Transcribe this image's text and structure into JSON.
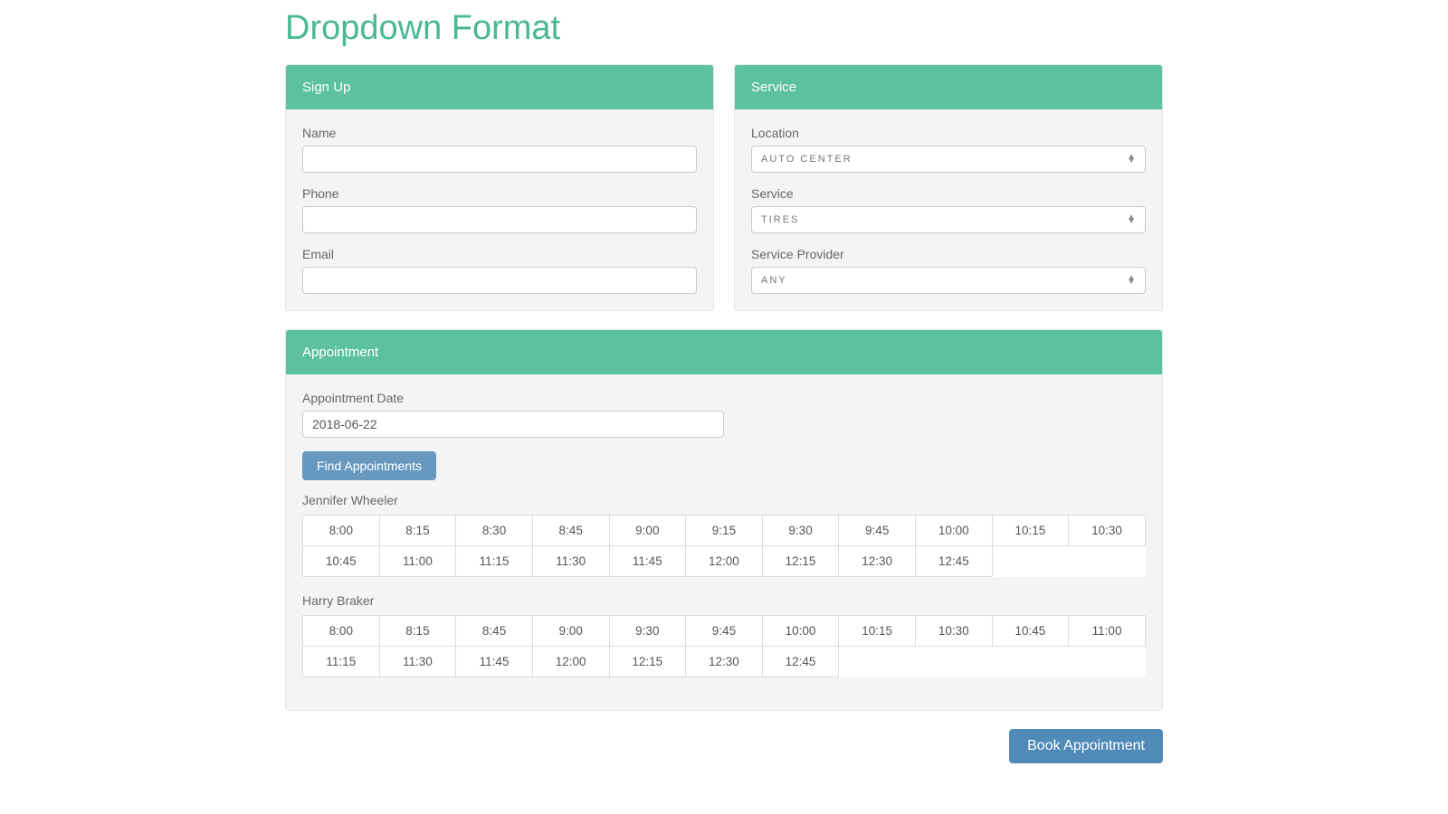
{
  "pageTitle": "Dropdown Format",
  "signup": {
    "heading": "Sign Up",
    "nameLabel": "Name",
    "nameValue": "",
    "phoneLabel": "Phone",
    "phoneValue": "",
    "emailLabel": "Email",
    "emailValue": ""
  },
  "service": {
    "heading": "Service",
    "locationLabel": "Location",
    "locationValue": "AUTO CENTER",
    "serviceLabel": "Service",
    "serviceValue": "TIRES",
    "providerLabel": "Service Provider",
    "providerValue": "ANY"
  },
  "appointment": {
    "heading": "Appointment",
    "dateLabel": "Appointment Date",
    "dateValue": "2018-06-22",
    "findLabel": "Find Appointments",
    "providers": [
      {
        "name": "Jennifer Wheeler",
        "slots": [
          "8:00",
          "8:15",
          "8:30",
          "8:45",
          "9:00",
          "9:15",
          "9:30",
          "9:45",
          "10:00",
          "10:15",
          "10:30",
          "10:45",
          "11:00",
          "11:15",
          "11:30",
          "11:45",
          "12:00",
          "12:15",
          "12:30",
          "12:45"
        ]
      },
      {
        "name": "Harry Braker",
        "slots": [
          "8:00",
          "8:15",
          "8:45",
          "9:00",
          "9:30",
          "9:45",
          "10:00",
          "10:15",
          "10:30",
          "10:45",
          "11:00",
          "11:15",
          "11:30",
          "11:45",
          "12:00",
          "12:15",
          "12:30",
          "12:45"
        ]
      }
    ]
  },
  "bookLabel": "Book Appointment"
}
